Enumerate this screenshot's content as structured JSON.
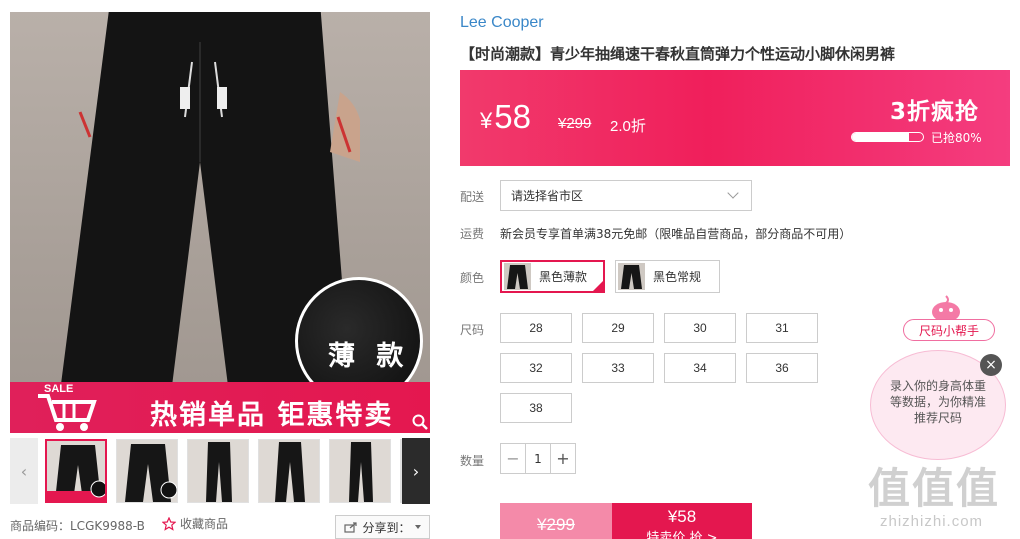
{
  "gallery": {
    "inset_label": "薄 款",
    "banner_text": "热销单品 钜惠特卖",
    "sale_badge": "SALE",
    "thumb_count": 6,
    "thumb_badge": "薄款",
    "prev_arrow": "‹",
    "next_arrow": "›"
  },
  "meta": {
    "product_code": "商品编码：LCGK9988-B",
    "favorite_label": "收藏商品",
    "share_label": "分享到："
  },
  "product": {
    "brand": "Lee Cooper",
    "title": "【时尚潮款】青少年抽绳速干春秋直筒弹力个性运动小脚休闲男裤"
  },
  "price": {
    "currency": "¥",
    "current": "58",
    "original": "¥299",
    "discount": "2.0折",
    "promo_label": "3折疯抢",
    "sold_percent": 80,
    "sold_text": "已抢80%"
  },
  "delivery": {
    "label": "配送",
    "placeholder": "请选择省市区"
  },
  "shipping": {
    "label": "运费",
    "text": "新会员专享首单满38元免邮（限唯品自营商品，部分商品不可用）"
  },
  "colors": {
    "label": "颜色",
    "options": [
      {
        "name": "黑色薄款",
        "selected": true
      },
      {
        "name": "黑色常规",
        "selected": false
      }
    ]
  },
  "sizes": {
    "label": "尺码",
    "options": [
      "28",
      "29",
      "30",
      "31",
      "32",
      "33",
      "34",
      "36",
      "38"
    ]
  },
  "quantity": {
    "label": "数量",
    "value": "1",
    "minus": "−",
    "plus": "+"
  },
  "buy": {
    "original": "¥299",
    "special_price": "¥58",
    "special_label": "特卖价 抢 >"
  },
  "size_helper": {
    "tag": "尺码小帮手",
    "bubble_text": "录入你的身高体重等数据，为你精准推荐尺码",
    "close": "×"
  },
  "watermark": {
    "logo": "值值值",
    "domain": "zhizhizhi.com"
  },
  "colors_theme": {
    "accent": "#e4174f",
    "brand_link": "#3a87c8"
  }
}
